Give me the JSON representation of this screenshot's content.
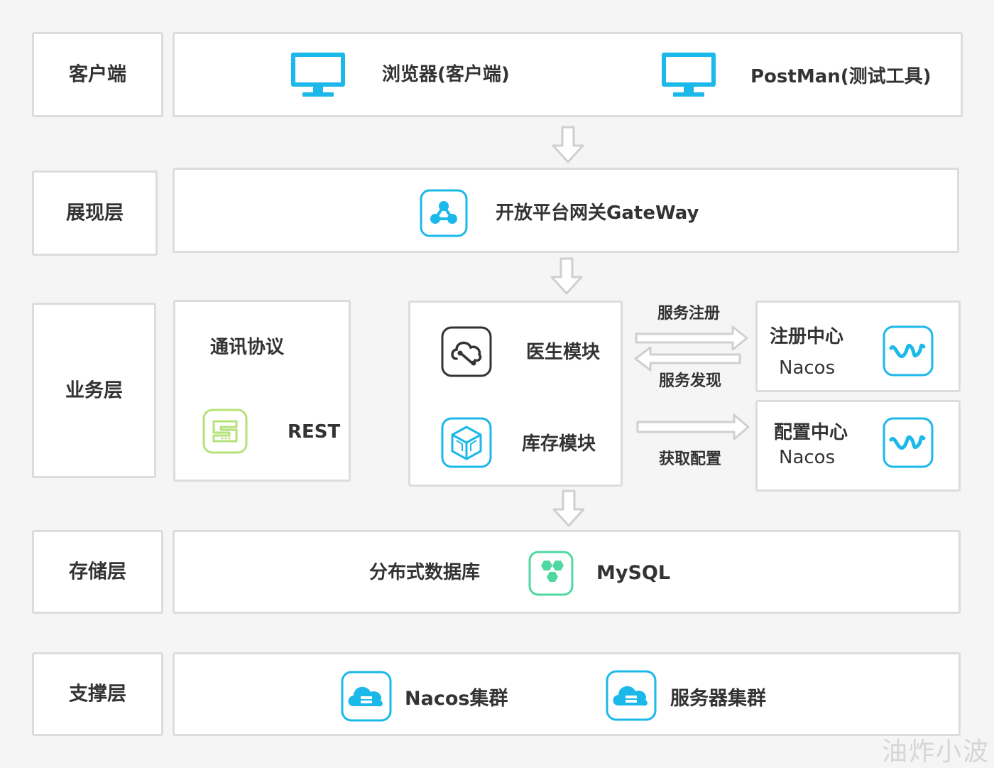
{
  "layers": {
    "client": {
      "label": "客户端",
      "items": [
        "浏览器(客户端)",
        "PostMan(测试工具)"
      ]
    },
    "presentation": {
      "label": "展现层",
      "gateway": "开放平台网关GateWay"
    },
    "business": {
      "label": "业务层",
      "protocol_title": "通讯协议",
      "protocol_name": "REST",
      "module_doctor": "医生模块",
      "module_inventory": "库存模块",
      "arrow_register": "服务注册",
      "arrow_discover": "服务发现",
      "arrow_config": "获取配置",
      "registry_title": "注册中心",
      "registry_name": "Nacos",
      "config_title": "配置中心",
      "config_name": "Nacos"
    },
    "storage": {
      "label": "存储层",
      "db_title": "分布式数据库",
      "db_name": "MySQL"
    },
    "support": {
      "label": "支撑层",
      "items": [
        "Nacos集群",
        "服务器集群"
      ]
    }
  },
  "icons": {
    "monitor": "monitor-icon",
    "gateway": "gateway-share-icon",
    "protocol": "rest-protocol-icon",
    "doctor": "cloud-link-icon",
    "inventory": "cube-icon",
    "nacos": "nacos-wave-icon",
    "mysql": "mysql-hexagon-icon",
    "cluster": "cloud-server-icon"
  },
  "colors": {
    "accent_blue": "#1bb8ea",
    "green": "#4fd8a0",
    "lime": "#b6e27a",
    "box_border": "#dcdcdc",
    "arrow": "#cfcfcf"
  },
  "watermark": "油炸小波"
}
